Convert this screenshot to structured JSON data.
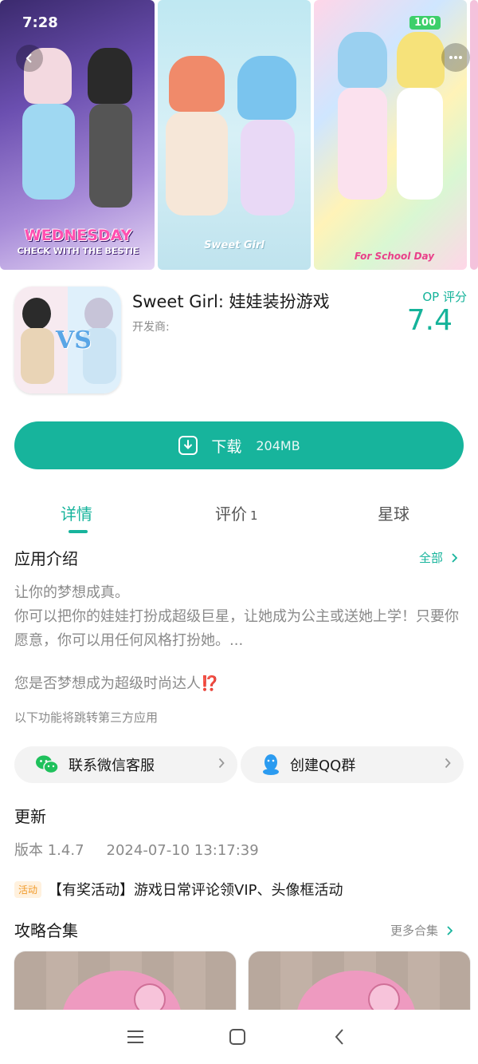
{
  "status_bar": {
    "time": "7:28",
    "battery": "100"
  },
  "screenshots": [
    {
      "caption": "WEDNESDAY",
      "subcaption": "CHECK WITH THE BESTIE"
    },
    {
      "caption": "Sweet Girl"
    },
    {
      "caption": "For School Day"
    }
  ],
  "app": {
    "title": "Sweet Girl: 娃娃装扮游戏",
    "developer_label": "开发商:",
    "icon_text": "VS",
    "score_label": "OP 评分",
    "score": "7.4"
  },
  "download": {
    "label": "下载",
    "size": "204MB"
  },
  "tabs": [
    {
      "label": "详情",
      "active": true
    },
    {
      "label": "评价",
      "count": "1"
    },
    {
      "label": "星球"
    }
  ],
  "intro": {
    "title": "应用介绍",
    "more": "全部",
    "line1": "让你的梦想成真。",
    "line2": "你可以把你的娃娃打扮成超级巨星，让她成为公主或送她上学！只要你愿意，你可以用任何风格打扮她。...",
    "question": "您是否梦想成为超级时尚达人⁉️",
    "third_party_note": "以下功能将跳转第三方应用"
  },
  "contacts": [
    {
      "label": "联系微信客服",
      "icon": "wechat-icon"
    },
    {
      "label": "创建QQ群",
      "icon": "qq-icon"
    }
  ],
  "update": {
    "title": "更新",
    "version": "版本 1.4.7",
    "date": "2024-07-10 13:17:39"
  },
  "activity": {
    "tag": "活动",
    "text": "【有奖活动】游戏日常评论领VIP、头像框活动"
  },
  "guides": {
    "title": "攻略合集",
    "more": "更多合集"
  },
  "colors": {
    "accent": "#17b49c",
    "muted": "#8a8a8a",
    "activity": "#f09a2a"
  }
}
